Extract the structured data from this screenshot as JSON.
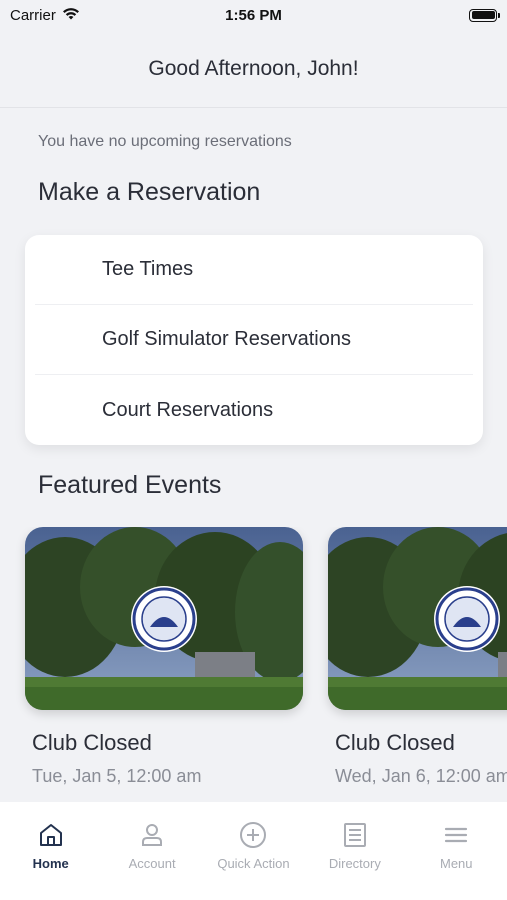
{
  "status_bar": {
    "carrier": "Carrier",
    "time": "1:56 PM"
  },
  "header": {
    "greeting": "Good Afternoon, John!"
  },
  "reservations_notice": "You have no upcoming reservations",
  "make_reservation": {
    "title": "Make a Reservation",
    "items": [
      {
        "label": "Tee Times"
      },
      {
        "label": "Golf Simulator Reservations"
      },
      {
        "label": "Court Reservations"
      }
    ]
  },
  "featured_events": {
    "title": "Featured Events",
    "events": [
      {
        "title": "Club Closed",
        "date": "Tue, Jan 5, 12:00 am"
      },
      {
        "title": "Club Closed",
        "date": "Wed, Jan 6, 12:00 am"
      }
    ]
  },
  "tab_bar": {
    "tabs": [
      {
        "label": "Home",
        "icon": "home-icon",
        "active": true
      },
      {
        "label": "Account",
        "icon": "person-icon",
        "active": false
      },
      {
        "label": "Quick Action",
        "icon": "plus-circle-icon",
        "active": false
      },
      {
        "label": "Directory",
        "icon": "list-icon",
        "active": false
      },
      {
        "label": "Menu",
        "icon": "hamburger-icon",
        "active": false
      }
    ],
    "active_color": "#23324f",
    "inactive_color": "#a9acb3"
  }
}
